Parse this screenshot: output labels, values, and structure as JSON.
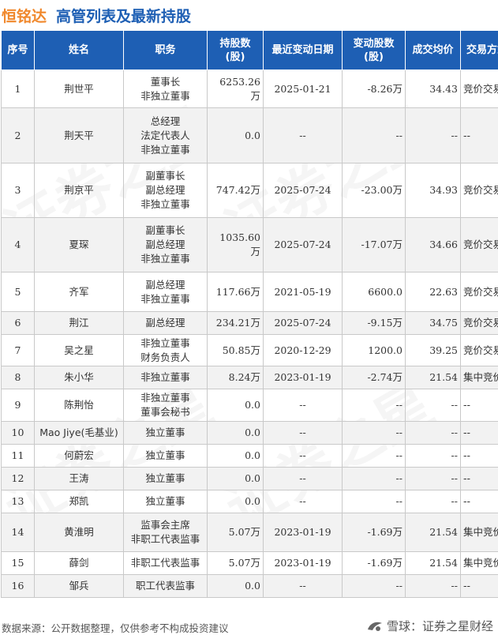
{
  "title": {
    "company": "恒铭达",
    "text": "高管列表及最新持股"
  },
  "watermark": "证券之星",
  "headers": [
    "序号",
    "姓名",
    "职务",
    "持股数\n(股)",
    "最近变动日期",
    "变动股数\n(股)",
    "成交均价",
    "交易方式"
  ],
  "rows": [
    {
      "no": "1",
      "name": "荆世平",
      "roles": [
        "董事长",
        "非独立董事"
      ],
      "shares": "6253.26万",
      "date": "2025-01-21",
      "change": "-8.26万",
      "price": "34.43",
      "method": "竞价交易",
      "sign": "neg"
    },
    {
      "no": "2",
      "name": "荆天平",
      "roles": [
        "总经理",
        "法定代表人",
        "非独立董事"
      ],
      "shares": "0.0",
      "date": "--",
      "change": "--",
      "price": "--",
      "method": "--",
      "sign": "none"
    },
    {
      "no": "3",
      "name": "荆京平",
      "roles": [
        "副董事长",
        "副总经理",
        "非独立董事"
      ],
      "shares": "747.42万",
      "date": "2025-07-24",
      "change": "-23.00万",
      "price": "34.93",
      "method": "竞价交易",
      "sign": "neg"
    },
    {
      "no": "4",
      "name": "夏琛",
      "roles": [
        "副董事长",
        "副总经理",
        "非独立董事"
      ],
      "shares": "1035.60万",
      "date": "2025-07-24",
      "change": "-17.07万",
      "price": "34.66",
      "method": "竞价交易",
      "sign": "neg"
    },
    {
      "no": "5",
      "name": "齐军",
      "roles": [
        "副总经理",
        "非独立董事"
      ],
      "shares": "117.66万",
      "date": "2021-05-19",
      "change": "6600.0",
      "price": "22.63",
      "method": "竞价交易",
      "sign": "pos"
    },
    {
      "no": "6",
      "name": "荆江",
      "roles": [
        "副总经理"
      ],
      "shares": "234.21万",
      "date": "2025-07-24",
      "change": "-9.15万",
      "price": "34.75",
      "method": "竞价交易",
      "sign": "neg"
    },
    {
      "no": "7",
      "name": "吴之星",
      "roles": [
        "非独立董事",
        "财务负责人"
      ],
      "shares": "50.85万",
      "date": "2020-12-29",
      "change": "1200.0",
      "price": "39.25",
      "method": "竞价交易",
      "sign": "pos"
    },
    {
      "no": "8",
      "name": "朱小华",
      "roles": [
        "非独立董事"
      ],
      "shares": "8.24万",
      "date": "2023-01-19",
      "change": "-2.74万",
      "price": "21.54",
      "method": "集中竞价",
      "sign": "neg"
    },
    {
      "no": "9",
      "name": "陈荆怡",
      "roles": [
        "非独立董事",
        "董事会秘书"
      ],
      "shares": "0.0",
      "date": "--",
      "change": "--",
      "price": "--",
      "method": "--",
      "sign": "none"
    },
    {
      "no": "10",
      "name": "Mao Jiye(毛基业)",
      "roles": [
        "独立董事"
      ],
      "shares": "0.0",
      "date": "--",
      "change": "--",
      "price": "--",
      "method": "--",
      "sign": "none"
    },
    {
      "no": "11",
      "name": "何蔚宏",
      "roles": [
        "独立董事"
      ],
      "shares": "0.0",
      "date": "--",
      "change": "--",
      "price": "--",
      "method": "--",
      "sign": "none"
    },
    {
      "no": "12",
      "name": "王涛",
      "roles": [
        "独立董事"
      ],
      "shares": "0.0",
      "date": "--",
      "change": "--",
      "price": "--",
      "method": "--",
      "sign": "none"
    },
    {
      "no": "13",
      "name": "郑凯",
      "roles": [
        "独立董事"
      ],
      "shares": "0.0",
      "date": "--",
      "change": "--",
      "price": "--",
      "method": "--",
      "sign": "none"
    },
    {
      "no": "14",
      "name": "黄淮明",
      "roles": [
        "监事会主席",
        "非职工代表监事"
      ],
      "shares": "5.07万",
      "date": "2023-01-19",
      "change": "-1.69万",
      "price": "21.54",
      "method": "集中竞价",
      "sign": "neg"
    },
    {
      "no": "15",
      "name": "薛剑",
      "roles": [
        "非职工代表监事"
      ],
      "shares": "5.07万",
      "date": "2023-01-19",
      "change": "-1.69万",
      "price": "21.54",
      "method": "集中竞价",
      "sign": "neg"
    },
    {
      "no": "16",
      "name": "邹兵",
      "roles": [
        "职工代表监事"
      ],
      "shares": "0.0",
      "date": "--",
      "change": "--",
      "price": "--",
      "method": "--",
      "sign": "none"
    }
  ],
  "footer": {
    "source": "数据来源：公开数据整理，仅供参考不构成投资建议",
    "brand": "雪球：证券之星财经"
  },
  "colors": {
    "header_bg": "#1e5fb4",
    "company": "#f0882c",
    "negative": "#2a9a2a",
    "positive": "#e02020"
  }
}
